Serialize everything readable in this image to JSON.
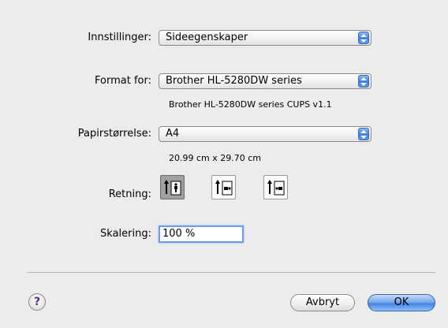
{
  "settings": {
    "label": "Innstillinger:",
    "value": "Sideegenskaper"
  },
  "format_for": {
    "label": "Format for:",
    "value": "Brother HL-5280DW series",
    "description": "Brother HL-5280DW series CUPS v1.1"
  },
  "paper_size": {
    "label": "Papirstørrelse:",
    "value": "A4",
    "dimensions": "20.99 cm x 29.70 cm"
  },
  "orientation": {
    "label": "Retning:",
    "options": [
      {
        "name": "portrait",
        "selected": true
      },
      {
        "name": "landscape-left",
        "selected": false
      },
      {
        "name": "landscape-right",
        "selected": false
      }
    ]
  },
  "scale": {
    "label": "Skalering:",
    "value": "100 %"
  },
  "buttons": {
    "help": "?",
    "cancel": "Avbryt",
    "ok": "OK"
  },
  "colors": {
    "accent": "#3f82e3",
    "background": "#ececec"
  }
}
